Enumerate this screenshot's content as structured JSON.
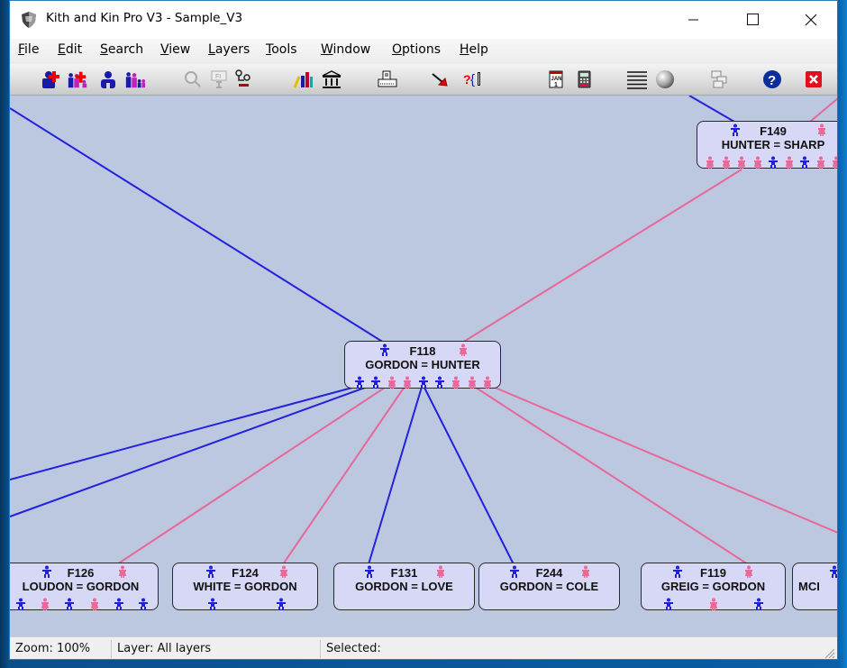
{
  "window": {
    "title": "Kith and Kin Pro V3 - Sample_V3",
    "controls": {
      "minimize": "—",
      "maximize": "☐",
      "close": "✕"
    }
  },
  "menu": [
    {
      "label": "File",
      "accel": "F",
      "rest": "ile"
    },
    {
      "label": "Edit",
      "accel": "E",
      "rest": "dit"
    },
    {
      "label": "Search",
      "accel": "S",
      "rest": "earch"
    },
    {
      "label": "View",
      "accel": "V",
      "rest": "iew"
    },
    {
      "label": "Layers",
      "accel": "L",
      "rest": "ayers"
    },
    {
      "label": "Tools",
      "accel": "T",
      "rest": "ools"
    },
    {
      "label": "Window",
      "accel": "W",
      "rest": "indow"
    },
    {
      "label": "Options",
      "accel": "O",
      "rest": "ptions"
    },
    {
      "label": "Help",
      "accel": "H",
      "rest": "elp"
    }
  ],
  "toolbar": [
    {
      "name": "add-person",
      "icon": "add-person-icon"
    },
    {
      "name": "add-family",
      "icon": "add-family-icon"
    },
    {
      "name": "person",
      "icon": "person-icon"
    },
    {
      "name": "family",
      "icon": "family-icon"
    },
    {
      "name": "find",
      "icon": "magnifier-icon"
    },
    {
      "name": "family-info",
      "icon": "family-info-icon"
    },
    {
      "name": "tree",
      "icon": "tree-icon"
    },
    {
      "name": "books",
      "icon": "books-icon"
    },
    {
      "name": "library",
      "icon": "building-icon"
    },
    {
      "name": "print",
      "icon": "printer-icon"
    },
    {
      "name": "pointer",
      "icon": "arrow-pointer-icon"
    },
    {
      "name": "query",
      "icon": "query-brace-icon"
    },
    {
      "name": "calendar",
      "icon": "calendar-icon"
    },
    {
      "name": "calculator",
      "icon": "calculator-icon"
    },
    {
      "name": "list",
      "icon": "list-lines-icon"
    },
    {
      "name": "sphere",
      "icon": "sphere-icon"
    },
    {
      "name": "layout",
      "icon": "layout-icon"
    },
    {
      "name": "help",
      "icon": "help-icon"
    },
    {
      "name": "exit",
      "icon": "exit-icon"
    }
  ],
  "families": [
    {
      "id": "F149",
      "names": "HUNTER = SHARP",
      "children": [
        "f",
        "f",
        "f",
        "f",
        "m",
        "f",
        "m",
        "f",
        "f"
      ]
    },
    {
      "id": "F118",
      "names": "GORDON = HUNTER",
      "children": [
        "m",
        "m",
        "f",
        "f",
        "m",
        "m",
        "f",
        "f",
        "f"
      ]
    },
    {
      "id": "F126",
      "names": "LOUDON = GORDON",
      "children": [
        "m",
        "f",
        "m",
        "f",
        "m",
        "m"
      ]
    },
    {
      "id": "F124",
      "names": "WHITE = GORDON",
      "children": [
        "m",
        "m"
      ]
    },
    {
      "id": "F131",
      "names": "GORDON = LOVE",
      "children": []
    },
    {
      "id": "F244",
      "names": "GORDON = COLE",
      "children": []
    },
    {
      "id": "F119",
      "names": "GREIG = GORDON",
      "children": [
        "m",
        "f",
        "m"
      ]
    },
    {
      "id": "",
      "names": "MCI",
      "children": []
    }
  ],
  "colors": {
    "male": "#2020d8",
    "female": "#e86a98",
    "canvas": "#bcc7e0",
    "box": "#d6d8f6"
  },
  "status": {
    "zoom": "Zoom: 100%",
    "layer": "Layer: All layers",
    "selected": "Selected:"
  }
}
